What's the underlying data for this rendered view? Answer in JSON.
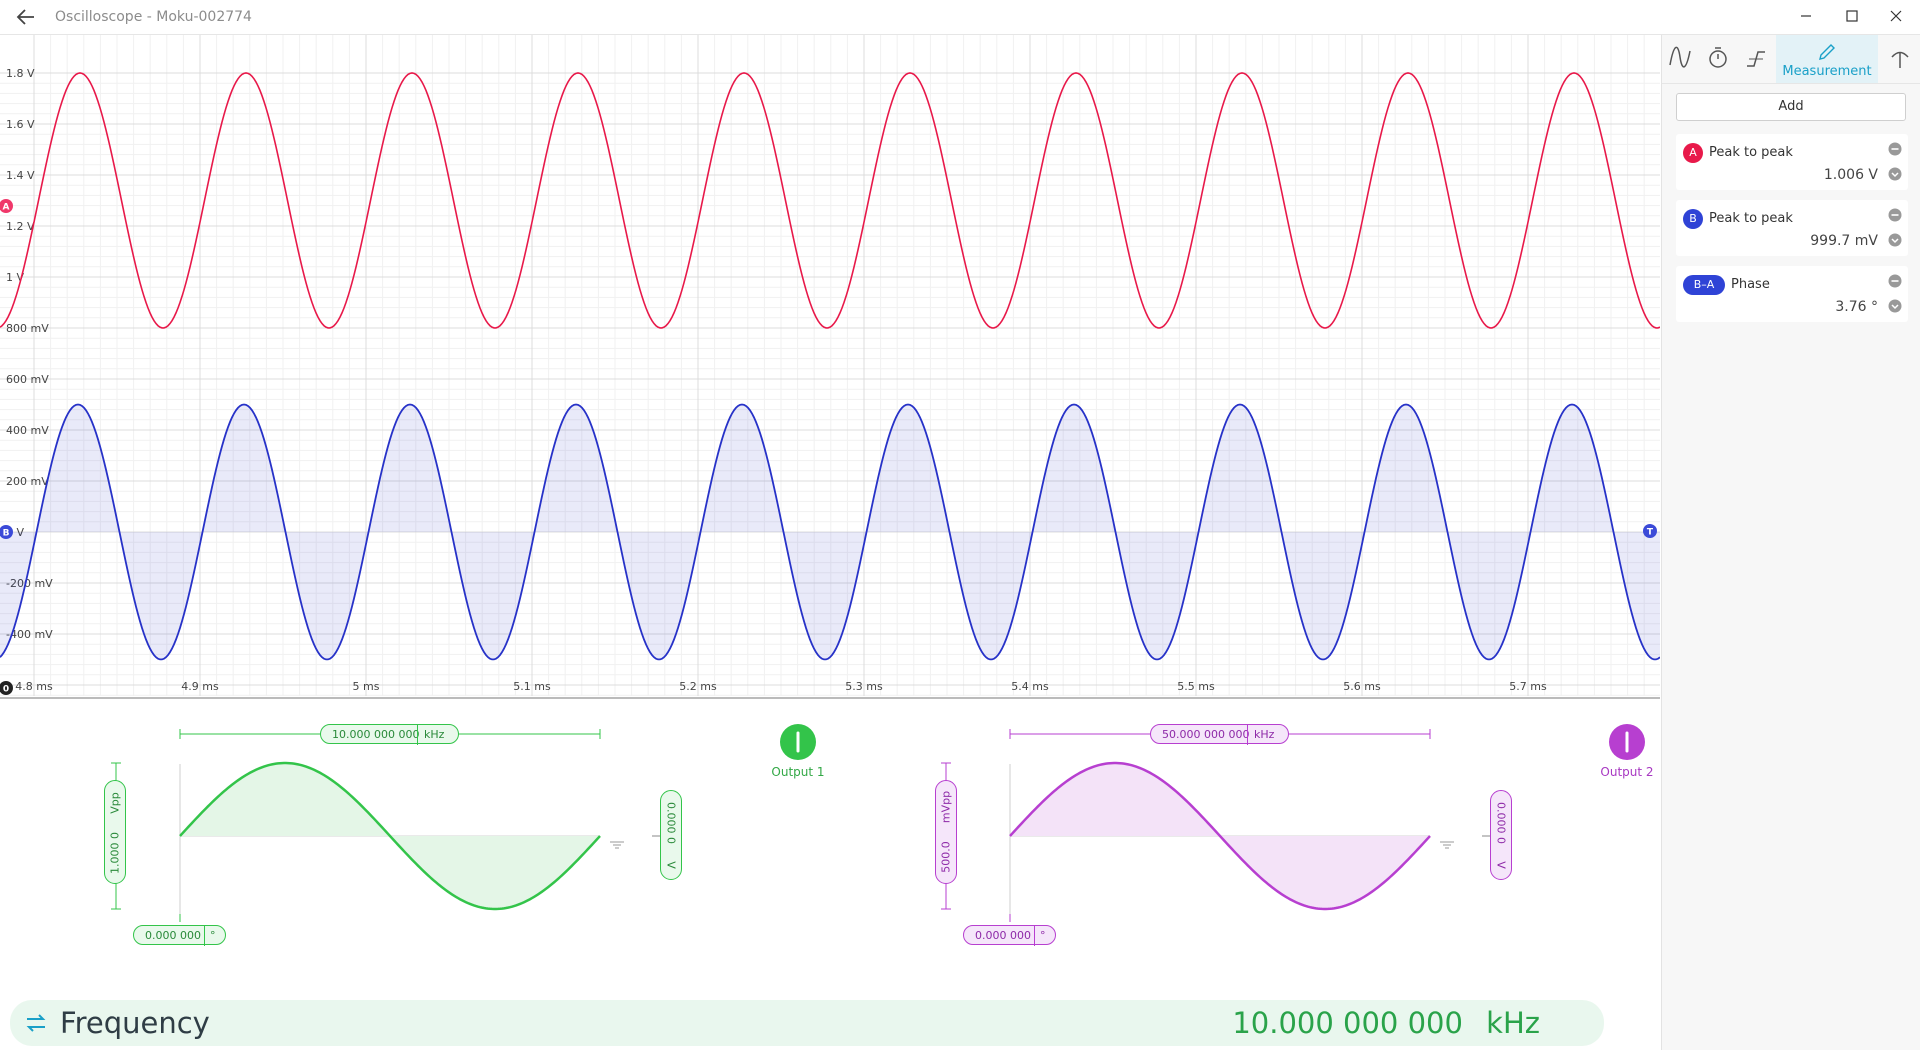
{
  "window": {
    "title": "Oscilloscope - Moku-002774"
  },
  "scope": {
    "y_labels_top": [
      "1.8 V",
      "1.6 V",
      "1.4 V",
      "1.2 V",
      "1 V",
      "800 mV"
    ],
    "y_labels_bottom": [
      "600 mV",
      "400 mV",
      "200 mV",
      "0 V",
      "-200 mV",
      "-400 mV"
    ],
    "x_labels": [
      "4.8 ms",
      "4.9 ms",
      "5 ms",
      "5.1 ms",
      "5.2 ms",
      "5.3 ms",
      "5.4 ms",
      "5.5 ms",
      "5.6 ms",
      "5.7 ms"
    ],
    "markers": {
      "a": "A",
      "b": "B",
      "trigger": "T",
      "zero": "0"
    },
    "channel_a_color": "#e8194a",
    "channel_b_color": "#2732c8"
  },
  "sidebar": {
    "tabs": [
      {
        "icon": "sine-wave-icon"
      },
      {
        "icon": "timer-icon"
      },
      {
        "icon": "trigger-edge-icon"
      },
      {
        "icon": "pencil-icon",
        "label": "Measurement"
      },
      {
        "icon": "probe-icon"
      }
    ],
    "add_label": "Add",
    "measurements": [
      {
        "channel": "A",
        "name": "Peak to peak",
        "value": "1.006 V",
        "color": "#e8194a"
      },
      {
        "channel": "B",
        "name": "Peak to peak",
        "value": "999.7 mV",
        "color": "#2f43d6"
      },
      {
        "channel": "B–A",
        "name": "Phase",
        "value": "3.76 °",
        "color": "#2f43d6"
      }
    ]
  },
  "generators": [
    {
      "frequency": "10.000 000 000",
      "frequency_unit": "kHz",
      "amplitude": "1.000 0",
      "amplitude_unit": "Vpp",
      "offset": "0.000 0",
      "offset_unit": "V",
      "phase": "0.000 000",
      "phase_unit": "°",
      "output_label": "Output 1",
      "color": "#33c44a"
    },
    {
      "frequency": "50.000 000 000",
      "frequency_unit": "kHz",
      "amplitude": "500.0",
      "amplitude_unit": "mVpp",
      "offset": "0.000 0",
      "offset_unit": "V",
      "phase": "0.000 000",
      "phase_unit": "°",
      "output_label": "Output 2",
      "color": "#b73fd0"
    }
  ],
  "footer": {
    "label": "Frequency",
    "value": "10.000 000 000",
    "unit": "kHz"
  }
}
